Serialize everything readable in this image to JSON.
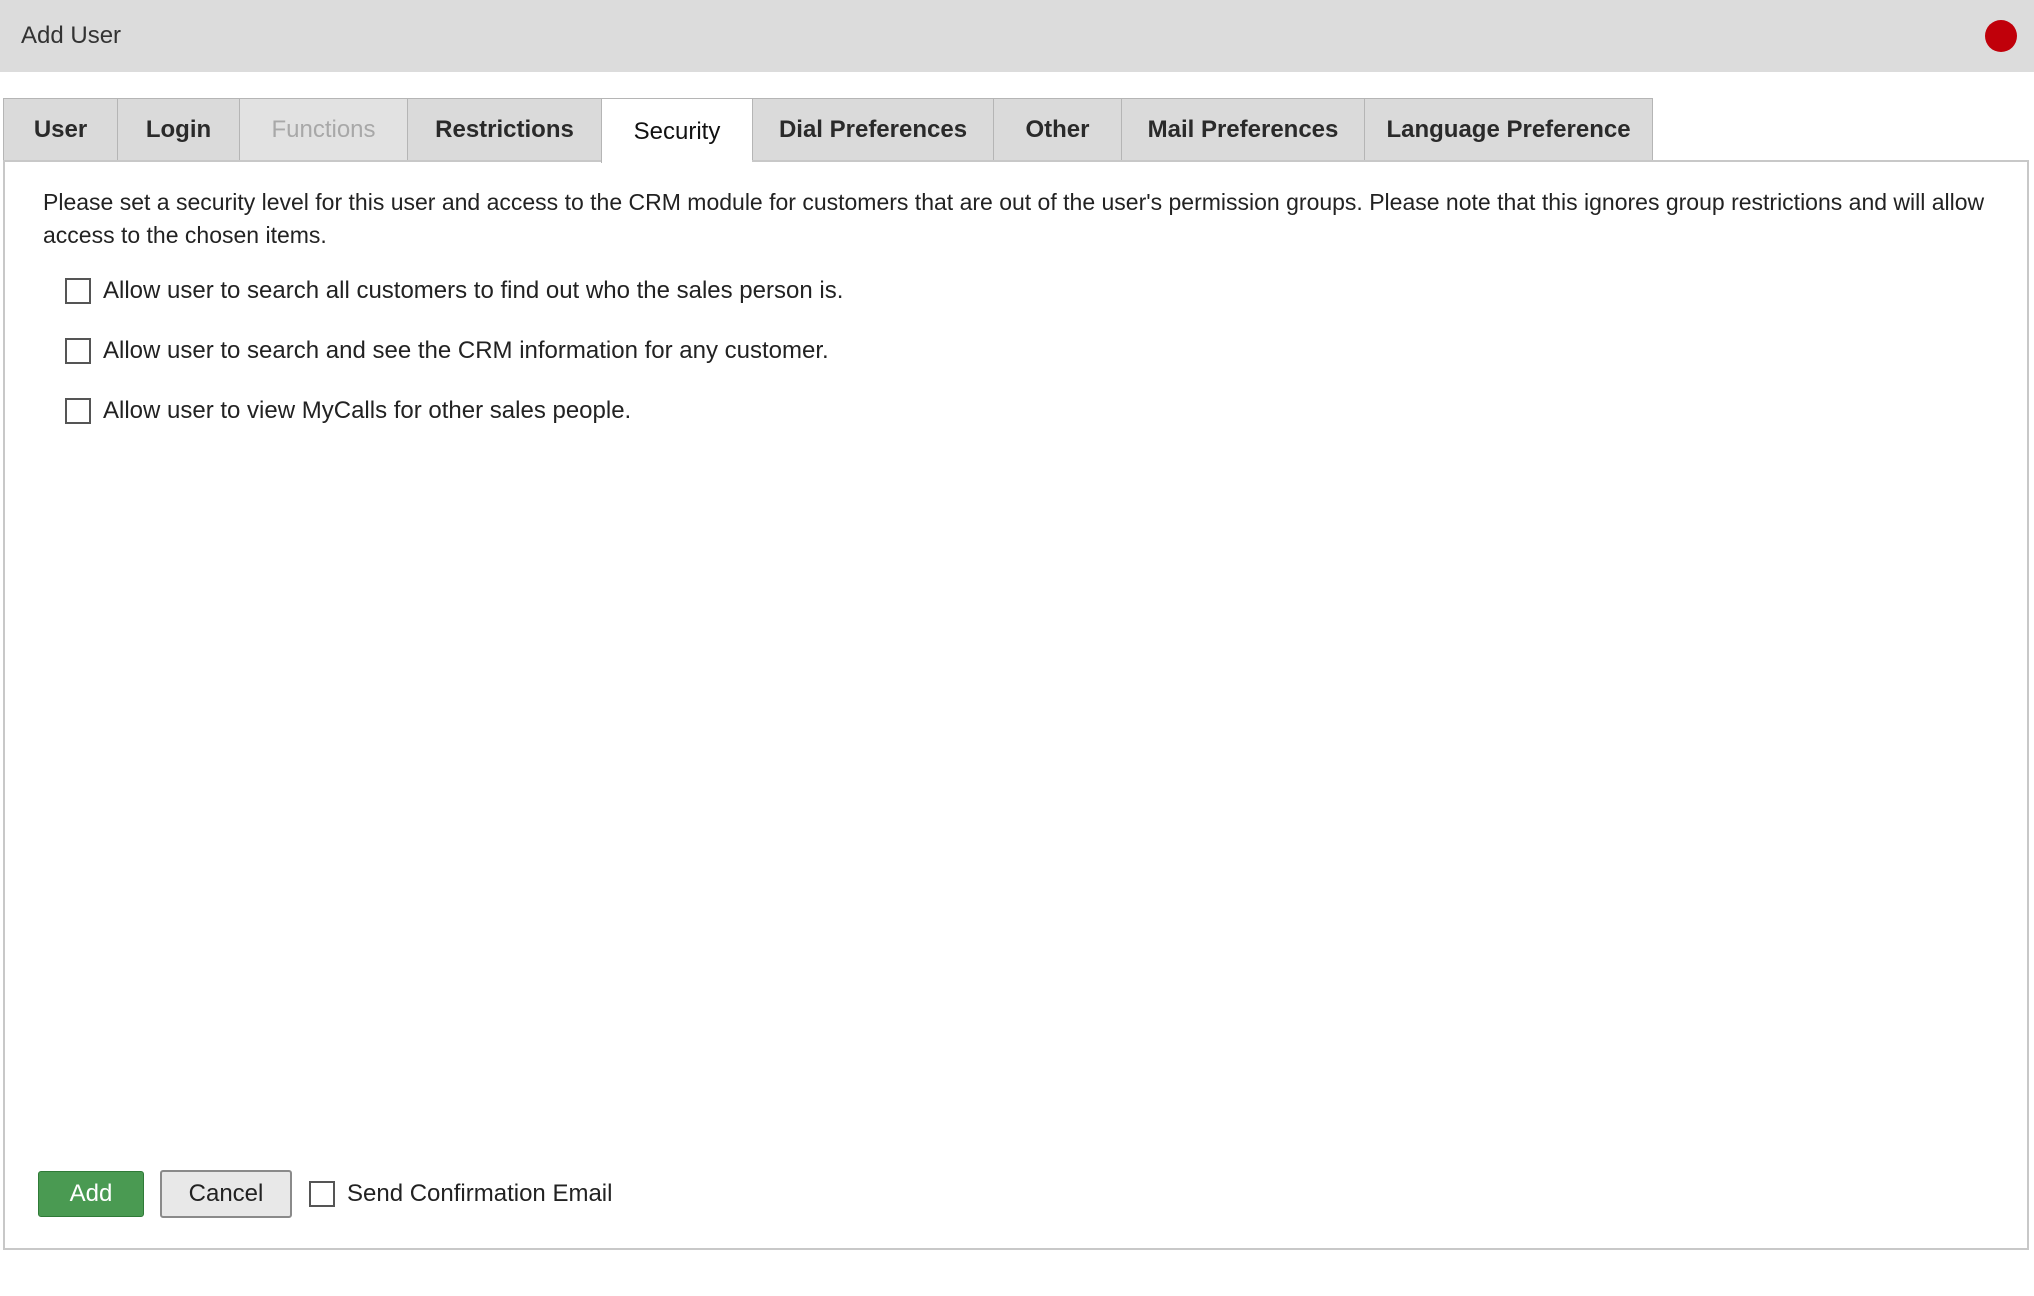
{
  "window": {
    "title": "Add User",
    "close_color": "#c0000a"
  },
  "tabs": [
    {
      "label": "User",
      "state": "normal"
    },
    {
      "label": "Login",
      "state": "normal"
    },
    {
      "label": "Functions",
      "state": "disabled"
    },
    {
      "label": "Restrictions",
      "state": "normal"
    },
    {
      "label": "Security",
      "state": "active"
    },
    {
      "label": "Dial Preferences",
      "state": "normal"
    },
    {
      "label": "Other",
      "state": "normal"
    },
    {
      "label": "Mail Preferences",
      "state": "normal"
    },
    {
      "label": "Language Preference",
      "state": "normal"
    }
  ],
  "security": {
    "intro": "Please set a security level for this user and access to the CRM module for customers that are out of the user's permission groups. Please note that this ignores group restrictions and will allow access to the chosen items.",
    "options": [
      {
        "label": "Allow user to search all customers to find out who the sales person is.",
        "checked": false
      },
      {
        "label": "Allow user to search and see the CRM information for any customer.",
        "checked": false
      },
      {
        "label": "Allow user to view MyCalls for other sales people.",
        "checked": false
      }
    ]
  },
  "footer": {
    "add_label": "Add",
    "cancel_label": "Cancel",
    "confirm_label": "Send Confirmation Email",
    "confirm_checked": false,
    "add_color": "#4a9a52"
  }
}
